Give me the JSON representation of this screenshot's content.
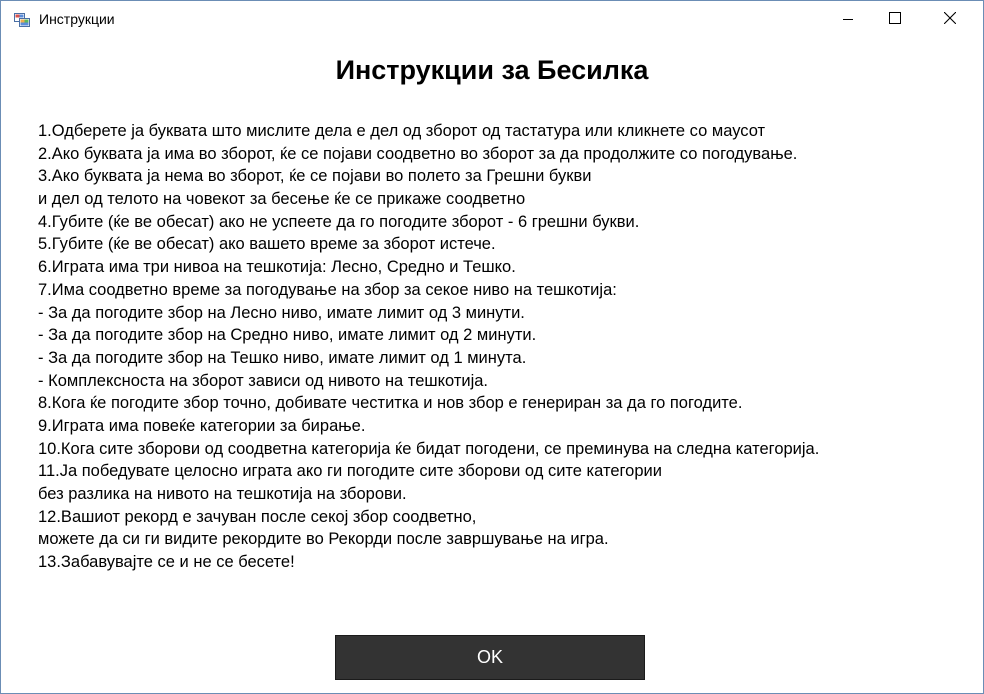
{
  "window": {
    "title": "Инструкции",
    "controls": {
      "minimize": "minimize-icon",
      "maximize": "maximize-icon",
      "close": "close-icon"
    }
  },
  "main": {
    "heading": "Инструкции за Бесилка",
    "instructions": [
      "1.Одберете ја буквата што мислите дела е дел од зборот од тастатура или кликнете со маусот",
      "2.Ако буквата ја има во зборот, ќе се појави соодветно во зборот за да продолжите со погодување.",
      "3.Ако буквата ја нема во зборот, ќе се појави во полето за Грешни букви",
      "и дел од телото на човекот за бесење ќе се прикаже соодветно",
      "4.Губите (ќе ве обесат) ако не успеете да го погодите зборот - 6 грешни букви.",
      "5.Губите (ќе ве обесат) ако вашето време за зборот истече.",
      "6.Играта има три нивоа на тешкотија: Лесно, Средно и Тешко.",
      "7.Има соодветно време за погодување на збор за секое ниво на тешкотија:",
      "- За да погодите збор на Лесно ниво, имате лимит од 3 минути.",
      "- За да погодите збор на Средно ниво, имате лимит од 2 минути.",
      "- За да погодите збор на Тешко ниво, имате лимит од 1 минута.",
      "- Комплексноста на зборот зависи од нивото на тешкотија.",
      "8.Кога ќе погодите збор точно, добивате честитка и нов збор е генериран за да го погодите.",
      "9.Играта има повеќе категории за бирање.",
      "10.Кога сите зборови од соодветна категорија ќе бидат погодени, се преминува на следна категорија.",
      "11.Ја победувате целосно играта ако ги погодите сите зборови од сите категории",
      "без разлика на нивото на тешкотија на зборови.",
      "12.Вашиот рекорд е зачуван после секој збор соодветно,",
      "можете да си ги видите рекордите во Рекорди после завршување на игра.",
      "13.Забавувајте се и не се бесете!"
    ],
    "ok_label": "OK"
  },
  "colors": {
    "button_bg": "#333333",
    "button_text": "#ffffff",
    "window_border": "#6b8db5"
  }
}
